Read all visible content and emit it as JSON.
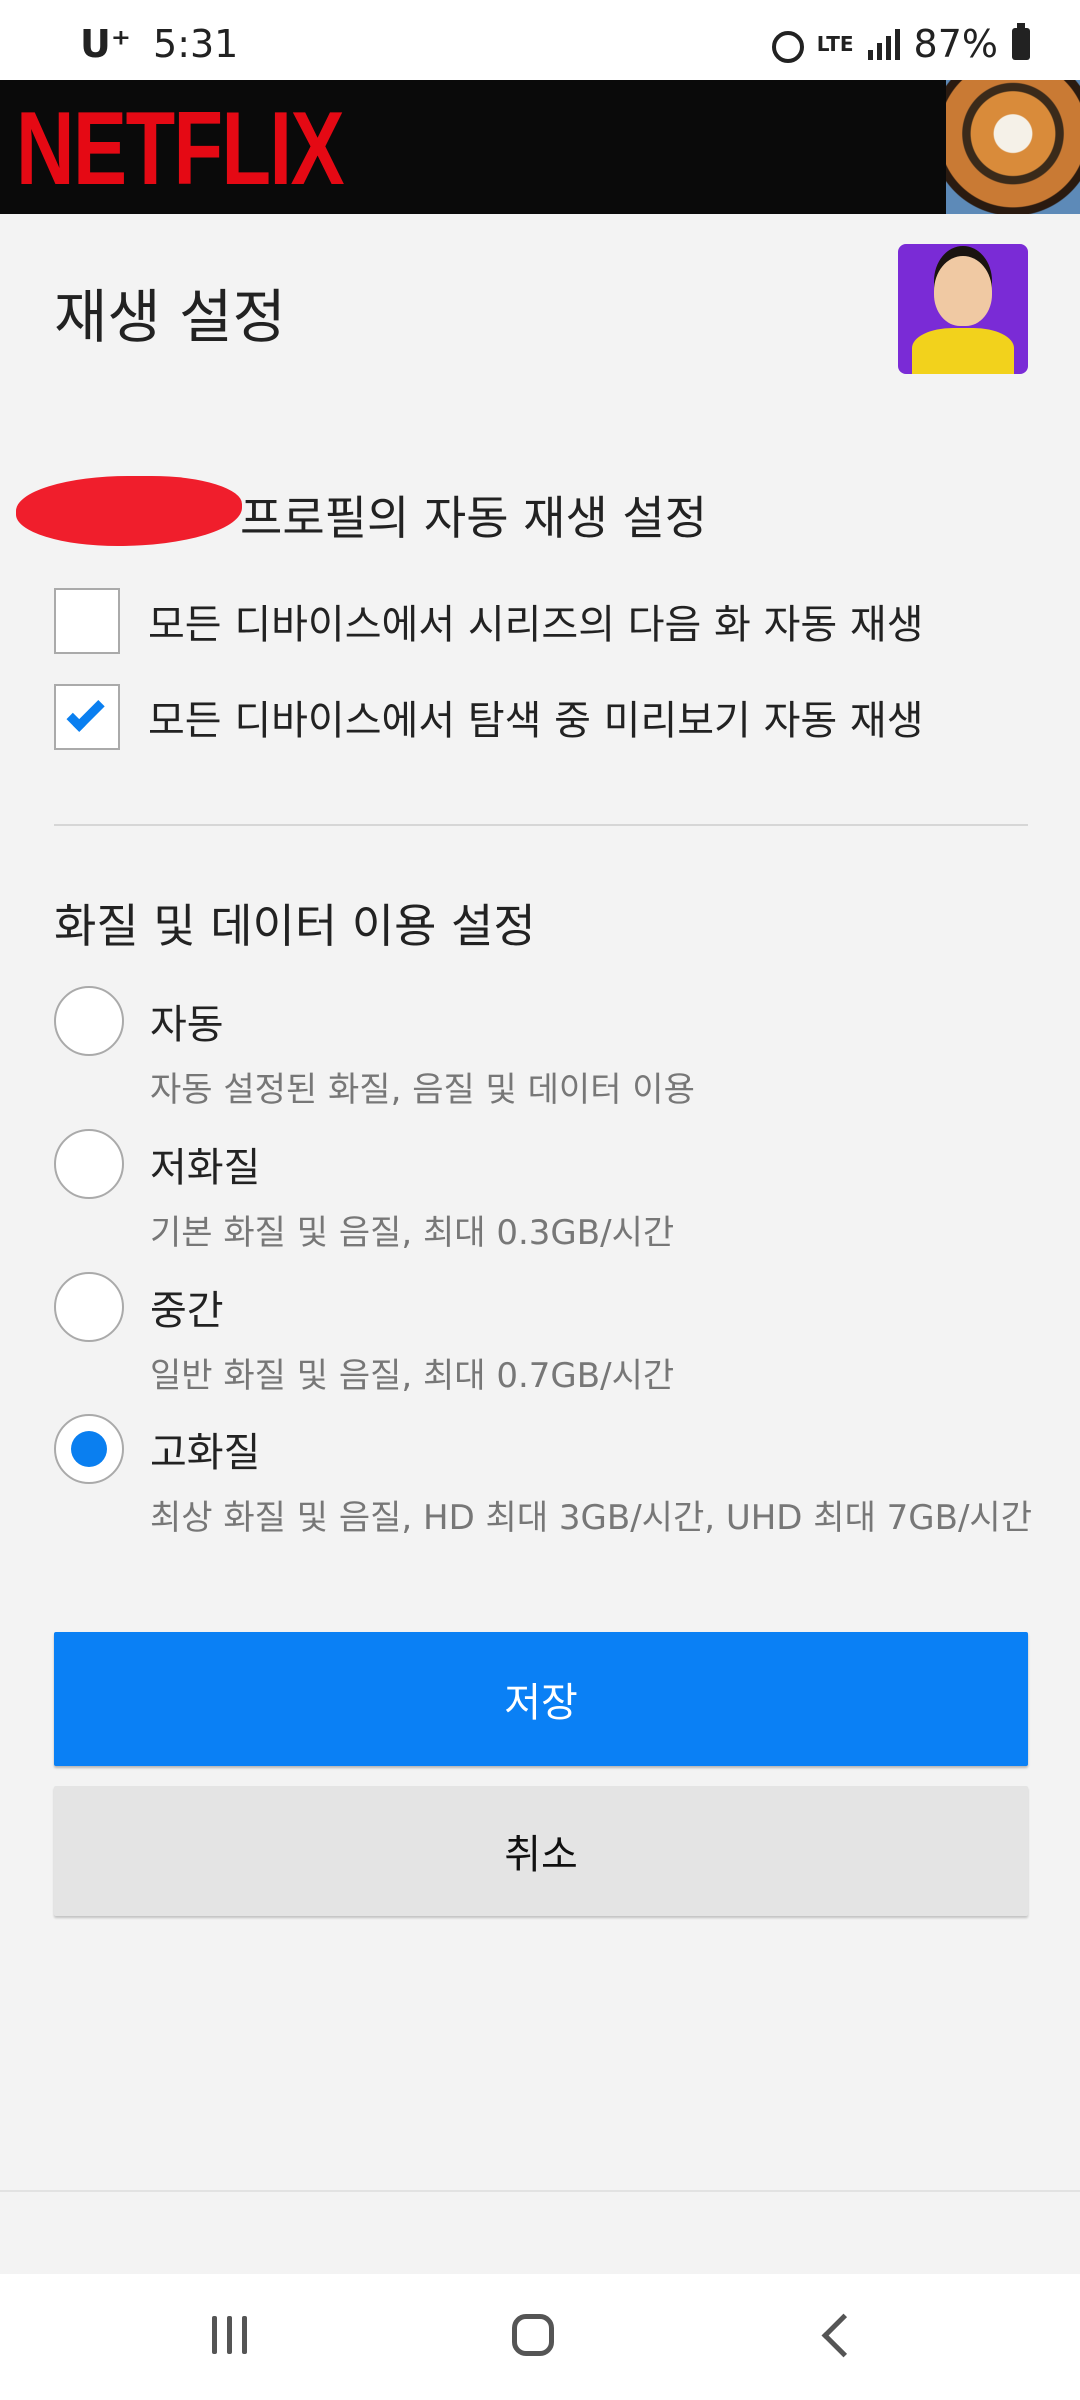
{
  "status_bar": {
    "carrier": "U⁺",
    "time": "5:31",
    "network": "LTE",
    "battery": "87%"
  },
  "header": {
    "logo": "NETFLIX"
  },
  "page": {
    "title": "재생 설정"
  },
  "autoplay": {
    "section_title": "프로필의 자동 재생 설정",
    "options": [
      {
        "label": "모든 디바이스에서 시리즈의 다음 화 자동 재생",
        "checked": false
      },
      {
        "label": "모든 디바이스에서 탐색 중 미리보기 자동 재생",
        "checked": true
      }
    ]
  },
  "quality": {
    "section_title": "화질 및 데이터 이용 설정",
    "selected": "고화질",
    "options": [
      {
        "label": "자동",
        "description": "자동 설정된 화질, 음질 및 데이터 이용"
      },
      {
        "label": "저화질",
        "description": "기본 화질 및 음질, 최대 0.3GB/시간"
      },
      {
        "label": "중간",
        "description": "일반 화질 및 음질, 최대 0.7GB/시간"
      },
      {
        "label": "고화질",
        "description": "최상 화질 및 음질, HD 최대 3GB/시간, UHD 최대 7GB/시간"
      }
    ]
  },
  "actions": {
    "save_label": "저장",
    "cancel_label": "취소"
  },
  "colors": {
    "netflix_red": "#e50914",
    "accent_blue": "#0a80f5"
  }
}
